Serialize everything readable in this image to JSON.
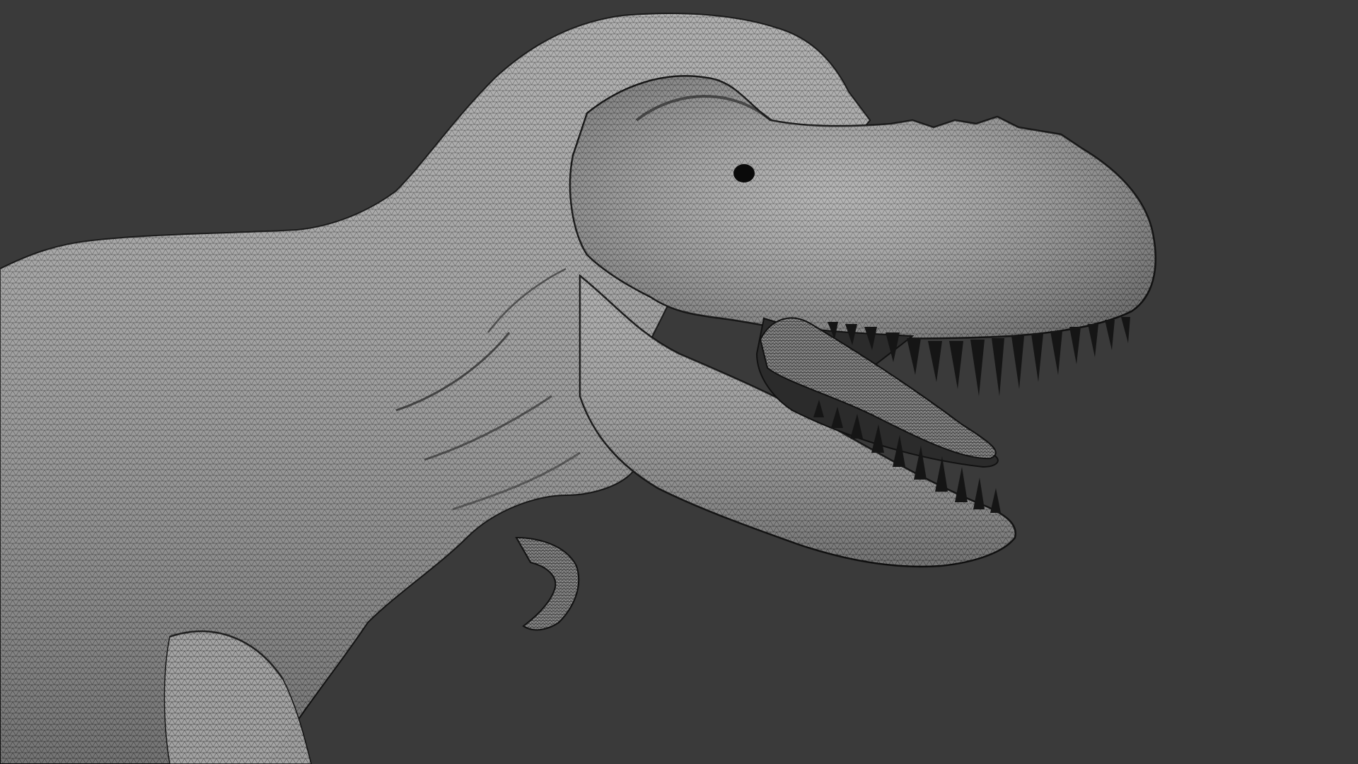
{
  "viewport": {
    "background_color": "#3a3a3a",
    "mesh_surface_color": "#9a9a9a",
    "wire_color": "#1a1a1a",
    "subject": "t-rex-model"
  }
}
